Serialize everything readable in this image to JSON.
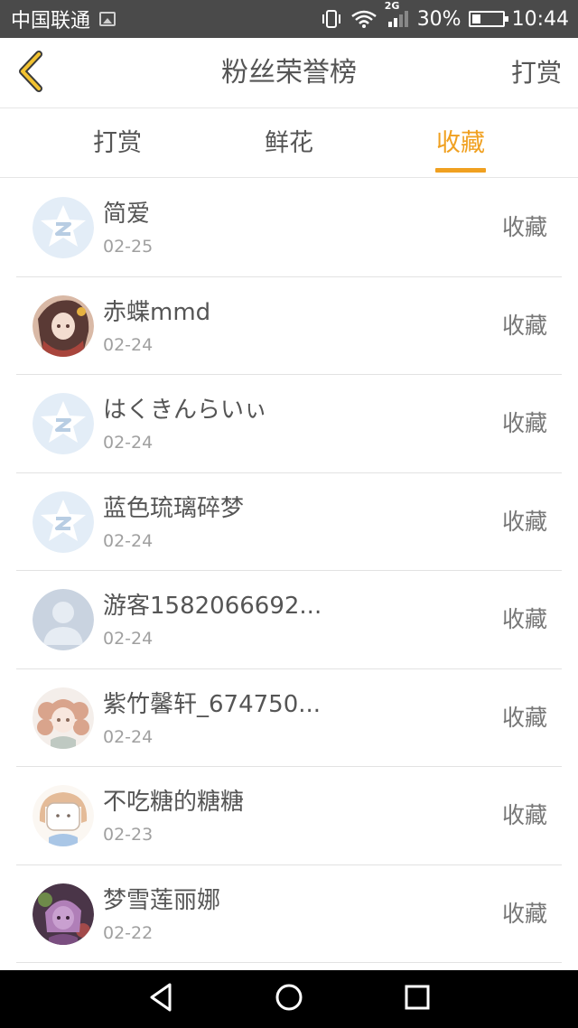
{
  "status_bar": {
    "carrier": "中国联通",
    "network": "2G",
    "battery": "30%",
    "battery_level": 0.3,
    "time": "10:44",
    "icons": [
      "image-notification-icon",
      "vibrate-icon",
      "wifi-icon",
      "signal-icon",
      "battery-icon"
    ]
  },
  "header": {
    "back_icon": "chevron-left-icon",
    "title": "粉丝荣誉榜",
    "action": "打赏"
  },
  "tabs": [
    {
      "label": "打赏",
      "active": false
    },
    {
      "label": "鲜花",
      "active": false
    },
    {
      "label": "收藏",
      "active": true
    }
  ],
  "colors": {
    "accent": "#f0a020",
    "status_bar": "#4a4a4a",
    "text": "#555555",
    "subtext": "#a0a0a0"
  },
  "fans": [
    {
      "name": "简爱",
      "date": "02-25",
      "action": "收藏",
      "avatar": "default-star-avatar"
    },
    {
      "name": "赤蝶mmd",
      "date": "02-24",
      "action": "收藏",
      "avatar": "anime-girl-avatar"
    },
    {
      "name": "はくきんらいぃ",
      "date": "02-24",
      "action": "收藏",
      "avatar": "default-star-avatar"
    },
    {
      "name": "蓝色琉璃碎梦",
      "date": "02-24",
      "action": "收藏",
      "avatar": "default-star-avatar"
    },
    {
      "name": "游客1582066692...",
      "date": "02-24",
      "action": "收藏",
      "avatar": "guest-silhouette-avatar"
    },
    {
      "name": "紫竹馨轩_674750...",
      "date": "02-24",
      "action": "收藏",
      "avatar": "curly-hair-girl-avatar"
    },
    {
      "name": "不吃糖的糖糖",
      "date": "02-23",
      "action": "收藏",
      "avatar": "sketch-girl-avatar"
    },
    {
      "name": "梦雪莲丽娜",
      "date": "02-22",
      "action": "收藏",
      "avatar": "purple-fantasy-avatar"
    }
  ],
  "nav_bar": {
    "back": "nav-back-icon",
    "home": "nav-home-icon",
    "recents": "nav-recents-icon"
  }
}
